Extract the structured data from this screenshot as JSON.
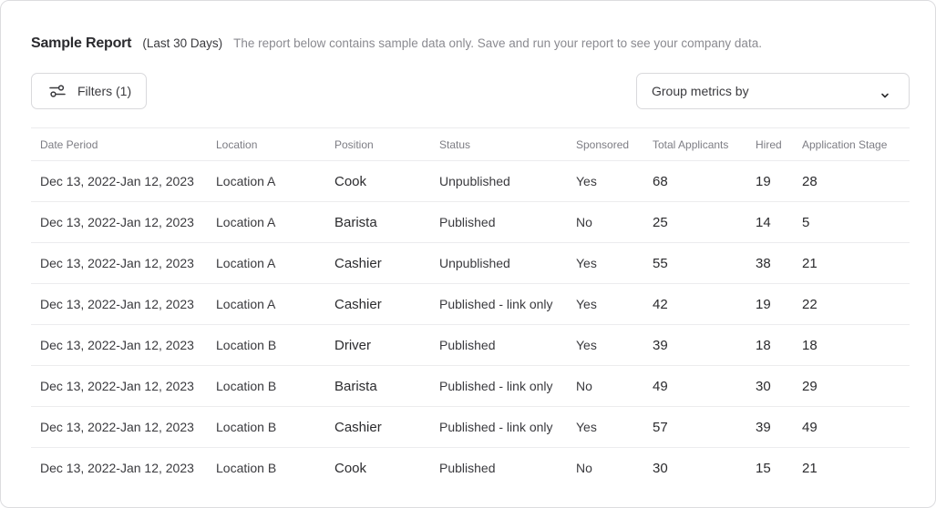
{
  "header": {
    "title": "Sample Report",
    "range": "(Last 30 Days)",
    "description": "The report below contains sample data only. Save and run your report to see your company data."
  },
  "toolbar": {
    "filters_label": "Filters (1)",
    "filters_icon": "sliders-icon",
    "group_metrics_label": "Group metrics by",
    "group_metrics_icon": "chevron-down-icon"
  },
  "table": {
    "columns": [
      "Date Period",
      "Location",
      "Position",
      "Status",
      "Sponsored",
      "Total Applicants",
      "Hired",
      "Application Stage"
    ],
    "rows": [
      {
        "date": "Dec 13, 2022-Jan 12, 2023",
        "location": "Location A",
        "position": "Cook",
        "status": "Unpublished",
        "sponsored": "Yes",
        "total": "68",
        "hired": "19",
        "stage": "28"
      },
      {
        "date": "Dec 13, 2022-Jan 12, 2023",
        "location": "Location A",
        "position": "Barista",
        "status": "Published",
        "sponsored": "No",
        "total": "25",
        "hired": "14",
        "stage": "5"
      },
      {
        "date": "Dec 13, 2022-Jan 12, 2023",
        "location": "Location A",
        "position": "Cashier",
        "status": "Unpublished",
        "sponsored": "Yes",
        "total": "55",
        "hired": "38",
        "stage": "21"
      },
      {
        "date": "Dec 13, 2022-Jan 12, 2023",
        "location": "Location A",
        "position": "Cashier",
        "status": "Published - link only",
        "sponsored": "Yes",
        "total": "42",
        "hired": "19",
        "stage": "22"
      },
      {
        "date": "Dec 13, 2022-Jan 12, 2023",
        "location": "Location B",
        "position": "Driver",
        "status": "Published",
        "sponsored": "Yes",
        "total": "39",
        "hired": "18",
        "stage": "18"
      },
      {
        "date": "Dec 13, 2022-Jan 12, 2023",
        "location": "Location B",
        "position": "Barista",
        "status": "Published - link only",
        "sponsored": "No",
        "total": "49",
        "hired": "30",
        "stage": "29"
      },
      {
        "date": "Dec 13, 2022-Jan 12, 2023",
        "location": "Location B",
        "position": "Cashier",
        "status": "Published - link only",
        "sponsored": "Yes",
        "total": "57",
        "hired": "39",
        "stage": "49"
      },
      {
        "date": "Dec 13, 2022-Jan 12, 2023",
        "location": "Location B",
        "position": "Cook",
        "status": "Published",
        "sponsored": "No",
        "total": "30",
        "hired": "15",
        "stage": "21"
      }
    ]
  }
}
